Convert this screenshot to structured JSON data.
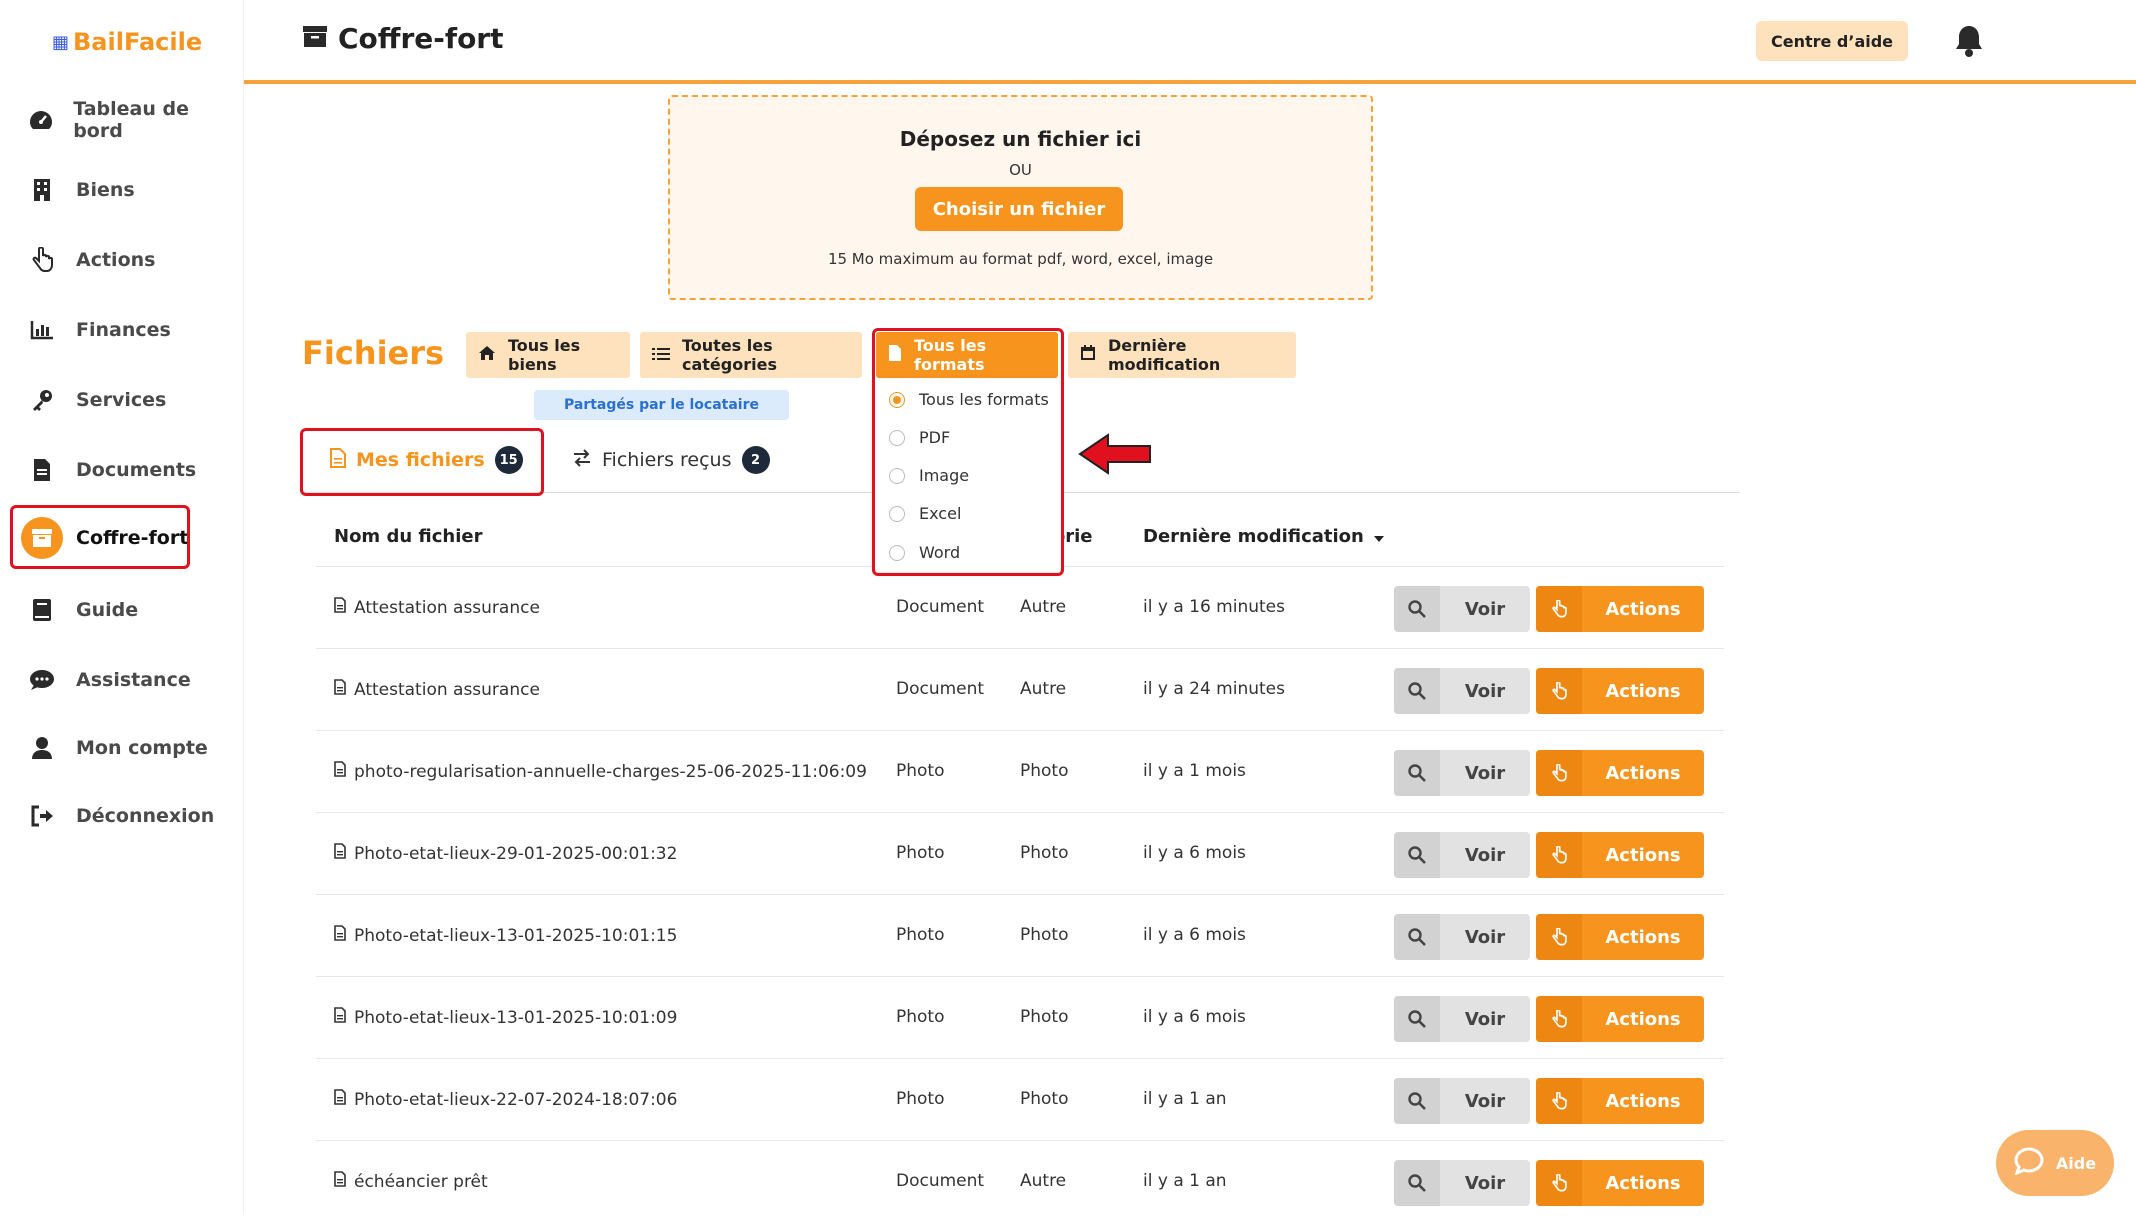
{
  "brand": {
    "name": "BailFacile",
    "color": "#f7941d"
  },
  "sidebar": {
    "items": [
      {
        "label": "Tableau de bord",
        "icon": "speedometer-icon"
      },
      {
        "label": "Biens",
        "icon": "building-icon"
      },
      {
        "label": "Actions",
        "icon": "pointer-hand-icon"
      },
      {
        "label": "Finances",
        "icon": "bar-chart-icon"
      },
      {
        "label": "Services",
        "icon": "key-icon"
      },
      {
        "label": "Documents",
        "icon": "document-icon"
      },
      {
        "label": "Coffre-fort",
        "icon": "archive-box-icon",
        "active": true
      },
      {
        "label": "Guide",
        "icon": "book-icon"
      },
      {
        "label": "Assistance",
        "icon": "chat-bubble-icon"
      },
      {
        "label": "Mon compte",
        "icon": "user-icon"
      },
      {
        "label": "Déconnexion",
        "icon": "logout-icon"
      }
    ]
  },
  "header": {
    "title": "Coffre-fort",
    "help_label": "Centre d’aide"
  },
  "dropzone": {
    "title": "Déposez un fichier ici",
    "or": "OU",
    "button": "Choisir un fichier",
    "note": "15 Mo maximum au format pdf, word, excel, image"
  },
  "files": {
    "title": "Fichiers",
    "filters": {
      "biens": "Tous les biens",
      "categories": "Toutes les catégories",
      "formats": "Tous les formats",
      "modified": "Dernière modification"
    },
    "shared_badge": "Partagés par le locataire",
    "tabs": {
      "mine": {
        "label": "Mes fichiers",
        "count": "15"
      },
      "received": {
        "label": "Fichiers reçus",
        "count": "2"
      }
    },
    "columns": {
      "name": "Nom du fichier",
      "category": "gorie",
      "modified": "Dernière modification"
    },
    "format_options": [
      "Tous les formats",
      "PDF",
      "Image",
      "Excel",
      "Word"
    ],
    "selected_format": "Tous les formats",
    "rows": [
      {
        "name": "Attestation assurance",
        "type": "Document",
        "category": "Autre",
        "modified": "il y a 16 minutes"
      },
      {
        "name": "Attestation assurance",
        "type": "Document",
        "category": "Autre",
        "modified": "il y a 24 minutes"
      },
      {
        "name": "photo-regularisation-annuelle-charges-25-06-2025-11:06:09",
        "type": "Photo",
        "category": "Photo",
        "modified": "il y a 1 mois"
      },
      {
        "name": "Photo-etat-lieux-29-01-2025-00:01:32",
        "type": "Photo",
        "category": "Photo",
        "modified": "il y a 6 mois"
      },
      {
        "name": "Photo-etat-lieux-13-01-2025-10:01:15",
        "type": "Photo",
        "category": "Photo",
        "modified": "il y a 6 mois"
      },
      {
        "name": "Photo-etat-lieux-13-01-2025-10:01:09",
        "type": "Photo",
        "category": "Photo",
        "modified": "il y a 6 mois"
      },
      {
        "name": "Photo-etat-lieux-22-07-2024-18:07:06",
        "type": "Photo",
        "category": "Photo",
        "modified": "il y a 1 an"
      },
      {
        "name": "échéancier prêt",
        "type": "Document",
        "category": "Autre",
        "modified": "il y a 1 an"
      }
    ],
    "row_actions": {
      "view": "Voir",
      "actions": "Actions"
    }
  },
  "aide_fab": "Aide",
  "colors": {
    "accent": "#f7941d",
    "accent_light": "#fde2bd",
    "highlight": "#e0101e"
  }
}
